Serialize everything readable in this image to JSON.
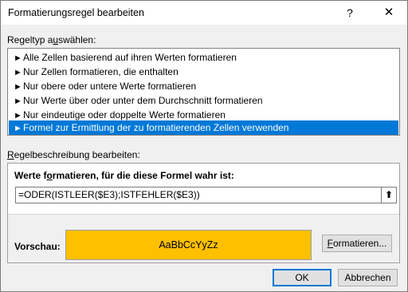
{
  "window": {
    "title": "Formatierungsregel bearbeiten",
    "help_glyph": "?",
    "close_glyph": "✕"
  },
  "ruletype": {
    "label_prefix": "Regeltyp a",
    "label_accel": "u",
    "label_suffix": "swählen:",
    "arrow_glyph": "►",
    "items": [
      {
        "label": "Alle Zellen basierend auf ihren Werten formatieren"
      },
      {
        "label": "Nur Zellen formatieren, die enthalten"
      },
      {
        "label": "Nur obere oder untere Werte formatieren"
      },
      {
        "label": "Nur Werte über oder unter dem Durchschnitt formatieren"
      },
      {
        "label": "Nur eindeutige oder doppelte Werte formatieren"
      },
      {
        "label": "Formel zur Ermittlung der zu formatierenden Zellen verwenden"
      }
    ],
    "selected_index": 5
  },
  "description": {
    "label_prefix": "",
    "label_accel": "R",
    "label_suffix": "egelbeschreibung bearbeiten:",
    "heading_prefix": "Werte f",
    "heading_accel": "o",
    "heading_suffix": "rmatieren, für die diese Formel wahr ist:",
    "formula": "=ODER(ISTLEER($E3);ISTFEHLER($E3))",
    "collapse_glyph": "⬆",
    "preview_label": "Vorschau:",
    "preview_text": "AaBbCcYyZz",
    "preview_color": "#ffc000",
    "format_button_accel": "F",
    "format_button_suffix": "ormatieren..."
  },
  "buttons": {
    "ok": "OK",
    "cancel": "Abbrechen"
  },
  "colors": {
    "selection": "#0078d7"
  }
}
